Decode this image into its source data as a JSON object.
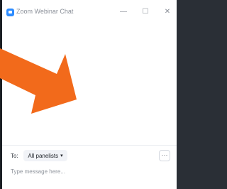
{
  "window": {
    "title": "Zoom Webinar Chat",
    "controls": {
      "minimize": "—",
      "maximize": "☐",
      "close": "✕"
    }
  },
  "composer": {
    "to_label": "To:",
    "recipient": "All panelists",
    "more": "···",
    "placeholder": "Type message here..."
  },
  "colors": {
    "accent": "#2d8cff",
    "annotation_arrow": "#f26a1b"
  }
}
